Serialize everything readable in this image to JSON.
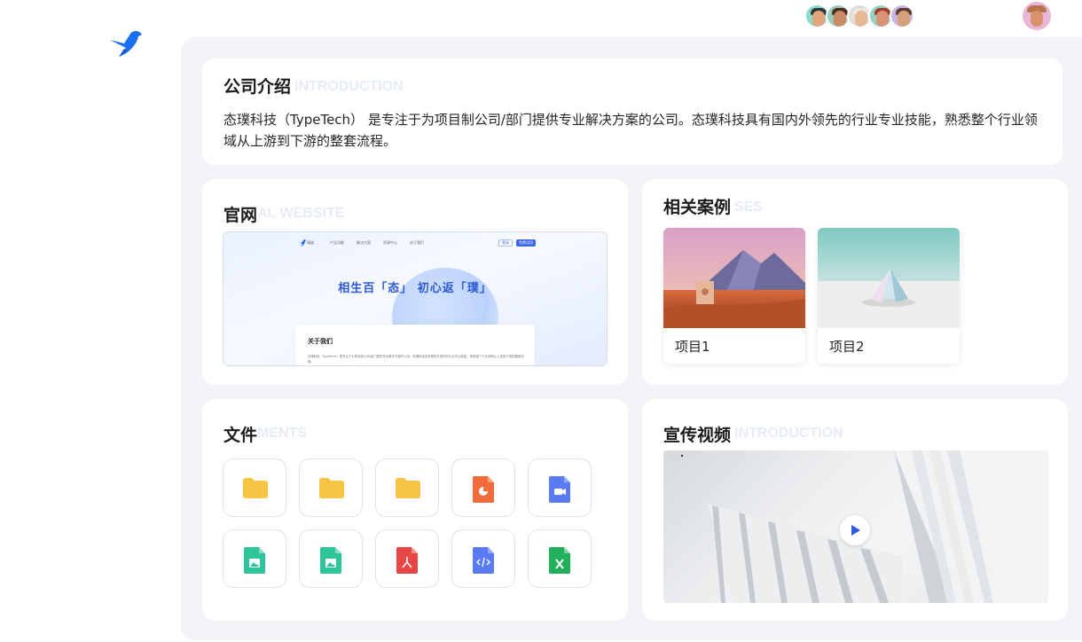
{
  "top": {
    "team_avatars": [
      "avatar-1",
      "avatar-2",
      "avatar-3",
      "avatar-4",
      "avatar-5"
    ],
    "user_avatar": "user-avatar"
  },
  "intro": {
    "title": "公司介绍",
    "ghost": "INTRODUCTION",
    "text": "态璞科技（TypeTech） 是专注于为项目制公司/部门提供专业解决方案的公司。态璞科技具有国内外领先的行业专业技能，熟悉整个行业领域从上游到下游的整套流程。"
  },
  "website": {
    "title": "官网",
    "ghost": "AL WEBSITE",
    "preview": {
      "brand": "璞道",
      "nav": [
        "产品功能",
        "解决方案",
        "资源中心",
        "关于我们"
      ],
      "login": "登录",
      "signup": "免费试用",
      "slogan": "相生百「态」  初心返「璞」",
      "about_title": "关于我们",
      "about_text": "态璞科技（TypeTech）是专注于为项目制公司/部门提供专业解决方案的公司。态璞科技具有国内外领先的行业专业技能，熟悉整个行业领域从上游到下游的整套流程。"
    }
  },
  "cases": {
    "title": "相关案例",
    "ghost": "SES",
    "items": [
      {
        "label": "项目1"
      },
      {
        "label": "项目2"
      }
    ]
  },
  "files": {
    "title": "文件",
    "ghost": "MENTS",
    "items": [
      {
        "type": "folder-icon"
      },
      {
        "type": "folder-icon"
      },
      {
        "type": "folder-icon"
      },
      {
        "type": "ppt-file-icon",
        "color": "#f26b3a"
      },
      {
        "type": "video-file-icon",
        "color": "#5b7bf5"
      },
      {
        "type": "image-file-icon",
        "color": "#2ec59a"
      },
      {
        "type": "image-file-icon",
        "color": "#2ec59a"
      },
      {
        "type": "pdf-file-icon",
        "color": "#e84545"
      },
      {
        "type": "code-file-icon",
        "color": "#5b7bf5"
      },
      {
        "type": "excel-file-icon",
        "color": "#23b05c"
      }
    ]
  },
  "video": {
    "title": "宣传视频",
    "ghost": "INTRODUCTION"
  },
  "colors": {
    "panel_bg": "#f3f4f7",
    "accent": "#3a63e6",
    "folder": "#f7c443"
  }
}
